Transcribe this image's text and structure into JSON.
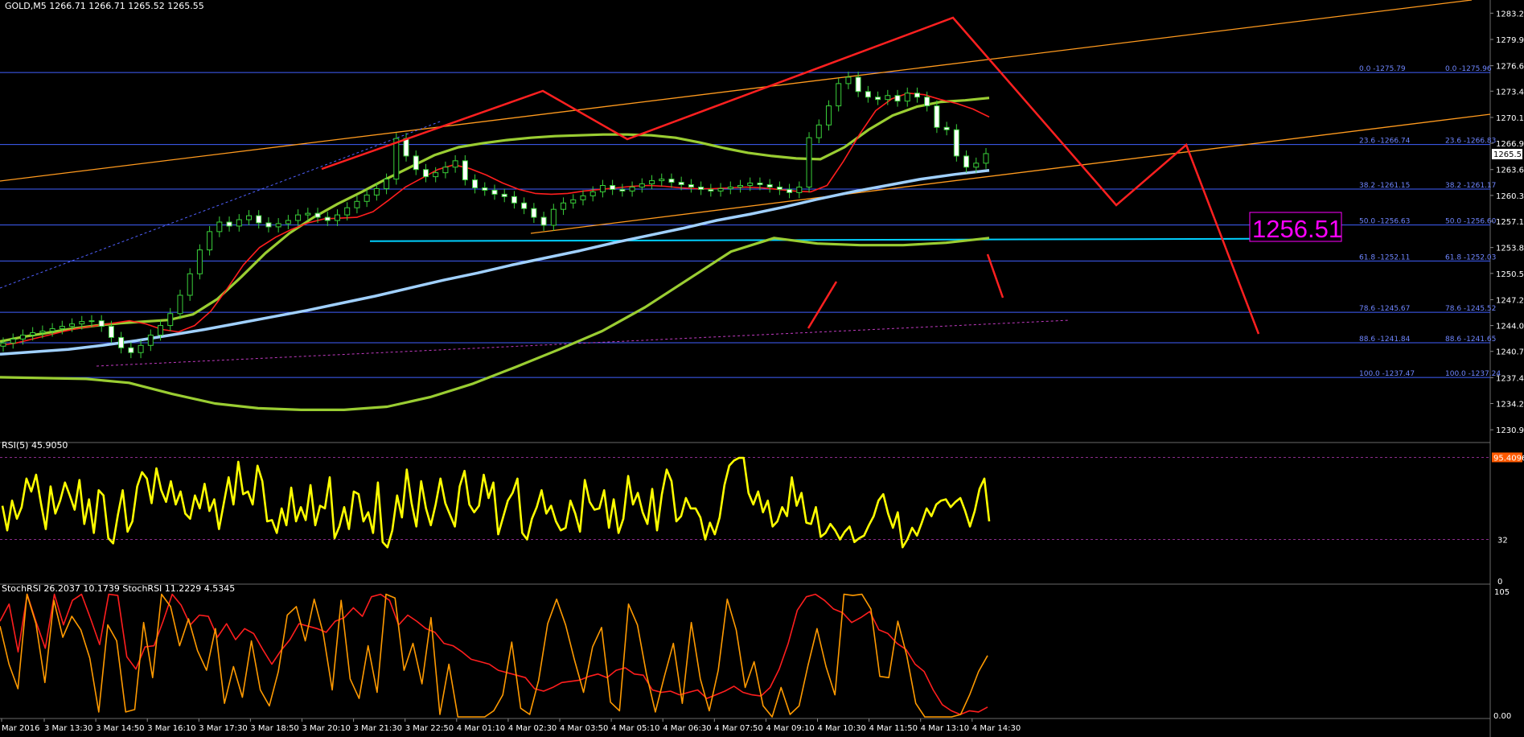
{
  "window": {
    "title": "GOLD,M5",
    "ohlc": "1266.71 1266.71 1265.52 1265.55",
    "current_price": "1265.55"
  },
  "colors": {
    "background": "#000000",
    "grid_fib": "#4060ff",
    "candle_up": "#3ad03a",
    "ma_red": "#ff1e1e",
    "ma_lime": "#9acd32",
    "ma_cyan": "#a0d0ff",
    "trend_orange": "#ff9a1e",
    "support_cyan": "#00d0ff",
    "arrow_red": "#ff2020",
    "target_magenta": "#ff00ff",
    "rsi_yellow": "#ffff00",
    "stoch_orange": "#ff9a00"
  },
  "target_label": "1256.51",
  "chart_data": [
    {
      "type": "line",
      "title": "GOLD,M5",
      "x_ticks": [
        "Mar 2016",
        "3 Mar 13:30",
        "3 Mar 14:50",
        "3 Mar 16:10",
        "3 Mar 17:30",
        "3 Mar 18:50",
        "3 Mar 20:10",
        "3 Mar 21:30",
        "3 Mar 22:50",
        "4 Mar 01:10",
        "4 Mar 02:30",
        "4 Mar 03:50",
        "4 Mar 05:10",
        "4 Mar 06:30",
        "4 Mar 07:50",
        "4 Mar 09:10",
        "4 Mar 10:30",
        "4 Mar 11:50",
        "4 Mar 13:10",
        "4 Mar 14:30"
      ],
      "y_ticks": [
        "1283.25",
        "1279.95",
        "1276.65",
        "1273.45",
        "1270.15",
        "1266.90",
        "1263.60",
        "1260.35",
        "1257.10",
        "1253.80",
        "1250.55",
        "1247.25",
        "1244.00",
        "1240.75",
        "1237.45",
        "1234.20",
        "1230.90"
      ],
      "ylim": [
        1229.5,
        1284.5
      ],
      "series": [
        {
          "type": "candlestick",
          "close": [
            1241.8,
            1242.3,
            1242.8,
            1243.1,
            1243.3,
            1243.6,
            1243.9,
            1244.2,
            1244.5,
            1244.6,
            1243.9,
            1242.5,
            1241.2,
            1240.6,
            1241.5,
            1242.8,
            1244.0,
            1245.5,
            1247.8,
            1250.5,
            1253.5,
            1255.8,
            1257.0,
            1256.5,
            1257.3,
            1257.8,
            1256.9,
            1256.4,
            1256.8,
            1257.2,
            1257.9,
            1258.1,
            1257.6,
            1257.2,
            1257.9,
            1258.8,
            1259.6,
            1260.4,
            1261.2,
            1262.4,
            1267.5,
            1265.3,
            1263.6,
            1262.7,
            1263.2,
            1263.9,
            1264.7,
            1262.3,
            1261.3,
            1261.0,
            1260.5,
            1260.2,
            1259.4,
            1258.7,
            1257.6,
            1256.6,
            1258.6,
            1259.4,
            1259.8,
            1260.3,
            1260.8,
            1261.6,
            1261.1,
            1260.9,
            1261.4,
            1261.8,
            1262.2,
            1262.4,
            1262.0,
            1261.7,
            1261.4,
            1261.1,
            1260.9,
            1261.2,
            1261.4,
            1261.6,
            1261.9,
            1261.7,
            1261.4,
            1261.1,
            1260.7,
            1261.4,
            1267.6,
            1269.2,
            1271.6,
            1274.4,
            1275.2,
            1273.4,
            1272.7,
            1272.4,
            1272.9,
            1272.2,
            1273.2,
            1272.7,
            1271.6,
            1268.9,
            1268.6,
            1265.3,
            1263.9,
            1264.4,
            1265.6
          ]
        },
        {
          "name": "",
          "values": [
            1241.5,
            1241.8,
            1242.3,
            1242.8,
            1243.3,
            1243.7,
            1244.0,
            1244.3,
            1244.6,
            1244.2,
            1243.5,
            1243.2,
            1244.0,
            1245.8,
            1248.6,
            1251.6,
            1253.8,
            1255.1,
            1256.1,
            1256.9,
            1257.4,
            1257.5,
            1257.6,
            1258.3,
            1259.8,
            1261.4,
            1262.5,
            1263.6,
            1264.2,
            1263.7,
            1262.9,
            1261.9,
            1261.1,
            1260.6,
            1260.5,
            1260.6,
            1260.9,
            1261.1,
            1261.3,
            1261.5,
            1261.6,
            1261.5,
            1261.3,
            1261.2,
            1261.2,
            1261.3,
            1261.4,
            1261.3,
            1261.1,
            1260.9,
            1260.8,
            1261.6,
            1264.6,
            1268.0,
            1271.0,
            1272.5,
            1273.2,
            1273.0,
            1272.4,
            1271.9,
            1271.2,
            1270.2
          ]
        },
        {
          "name": "",
          "values": [
            1242.0,
            1242.6,
            1243.1,
            1243.6,
            1244.0,
            1244.3,
            1244.5,
            1244.7,
            1245.4,
            1247.3,
            1250.1,
            1253.1,
            1255.6,
            1257.6,
            1259.3,
            1260.8,
            1262.4,
            1263.9,
            1265.4,
            1266.4,
            1266.9,
            1267.3,
            1267.6,
            1267.8,
            1267.9,
            1268.0,
            1268.0,
            1267.9,
            1267.6,
            1267.0,
            1266.3,
            1265.7,
            1265.3,
            1265.0,
            1264.9,
            1266.4,
            1268.6,
            1270.4,
            1271.5,
            1272.1,
            1272.3,
            1272.6
          ]
        },
        {
          "name": "",
          "values": [
            1240.4,
            1240.7,
            1241.0,
            1241.5,
            1242.1,
            1242.8,
            1243.5,
            1244.3,
            1245.1,
            1245.9,
            1246.8,
            1247.7,
            1248.7,
            1249.7,
            1250.6,
            1251.6,
            1252.5,
            1253.4,
            1254.4,
            1255.3,
            1256.2,
            1257.2,
            1258.0,
            1258.9,
            1259.9,
            1260.8,
            1261.6,
            1262.4,
            1263.0,
            1263.5
          ]
        },
        {
          "name": "",
          "values": [
            1237.5,
            1237.4,
            1237.3,
            1236.8,
            1235.4,
            1234.2,
            1233.6,
            1233.4,
            1233.4,
            1233.8,
            1235.0,
            1236.7,
            1238.8,
            1241.0,
            1243.3,
            1246.3,
            1249.8,
            1253.3,
            1255.0,
            1254.3,
            1254.1,
            1254.1,
            1254.4,
            1255.0
          ]
        }
      ],
      "fibonacci": [
        {
          "level": "0.0",
          "value": "1275.79",
          "value_right": "1275.96"
        },
        {
          "level": "23.6",
          "value": "1266.74",
          "value_right": "1266.83"
        },
        {
          "level": "38.2",
          "value": "1261.15",
          "value_right": "1261.17"
        },
        {
          "level": "50.0",
          "value": "1256.63",
          "value_right": "1256.60"
        },
        {
          "level": "61.8",
          "value": "1252.11",
          "value_right": "1252.03"
        },
        {
          "level": "78.6",
          "value": "1245.67",
          "value_right": "1245.52"
        },
        {
          "level": "88.6",
          "value": "1241.84",
          "value_right": "1241.65"
        },
        {
          "level": "100.0",
          "value": "1237.47",
          "value_right": "1237.24"
        }
      ],
      "support_level": 1254.9
    },
    {
      "type": "line",
      "title": "RSI(5) 45.9050",
      "y_ticks": [
        "95.4096",
        "32",
        "0"
      ],
      "ylim": [
        0,
        105
      ],
      "levels": [
        95.4,
        32
      ],
      "series": [
        {
          "name": "RSI(5)",
          "values": [
            58,
            39,
            62,
            48,
            57,
            79,
            69,
            82,
            60,
            40,
            73,
            52,
            62,
            76,
            66,
            55,
            78,
            44,
            63,
            37,
            70,
            66,
            33,
            29,
            51,
            70,
            38,
            46,
            73,
            84,
            79,
            60,
            87,
            70,
            61,
            77,
            59,
            69,
            52,
            48,
            66,
            56,
            75,
            54,
            63,
            40,
            60,
            80,
            59,
            92,
            67,
            69,
            59,
            89,
            77,
            46,
            47,
            37,
            56,
            43,
            72,
            46,
            57,
            47,
            74,
            43,
            58,
            56,
            80,
            33,
            42,
            57,
            40,
            69,
            67,
            46,
            53,
            37,
            76,
            30,
            26,
            39,
            66,
            49,
            86,
            60,
            42,
            77,
            56,
            43,
            59,
            79,
            60,
            51,
            42,
            73,
            85,
            59,
            53,
            58,
            82,
            64,
            76,
            36,
            49,
            62,
            68,
            79,
            37,
            32,
            48,
            57,
            70,
            52,
            58,
            46,
            39,
            41,
            62,
            52,
            38,
            78,
            61,
            55,
            56,
            70,
            41,
            63,
            37,
            48,
            81,
            59,
            68,
            53,
            44,
            71,
            39,
            67,
            86,
            77,
            46,
            50,
            64,
            56,
            56,
            49,
            32,
            45,
            36,
            49,
            74,
            89,
            93,
            95,
            95,
            68,
            59,
            69,
            53,
            62,
            42,
            46,
            57,
            50,
            80,
            58,
            68,
            45,
            44,
            57,
            34,
            37,
            44,
            39,
            32,
            38,
            42,
            30,
            33,
            35,
            43,
            50,
            62,
            67,
            52,
            41,
            53,
            26,
            32,
            41,
            35,
            45,
            56,
            50,
            59,
            62,
            63,
            57,
            61,
            64,
            54,
            42,
            54,
            71,
            79,
            46
          ]
        }
      ]
    },
    {
      "type": "line",
      "title": "StochRSI 26.2037 10.1739  StochRSI 11.2229 4.5345",
      "y_ticks": [
        "105",
        "0.00"
      ],
      "ylim": [
        0,
        105
      ],
      "series": [
        {
          "name": "StochRSI",
          "values": [
            78,
            92,
            53,
            100,
            77,
            56,
            100,
            75,
            95,
            100,
            80,
            59,
            100,
            99,
            49,
            39,
            57,
            58,
            78,
            100,
            91,
            75,
            83,
            82,
            65,
            76,
            63,
            72,
            68,
            55,
            43,
            54,
            63,
            76,
            74,
            72,
            69,
            78,
            81,
            89,
            82,
            98,
            100,
            95,
            75,
            83,
            78,
            72,
            69,
            60,
            58,
            53,
            47,
            45,
            43,
            38,
            36,
            34,
            32,
            23,
            21,
            24,
            28,
            29,
            30,
            33,
            35,
            32,
            38,
            40,
            35,
            34,
            22,
            20,
            21,
            18,
            20,
            22,
            15,
            18,
            21,
            25,
            20,
            18,
            17,
            24,
            39,
            60,
            87,
            98,
            100,
            95,
            88,
            85,
            77,
            81,
            86,
            71,
            68,
            60,
            55,
            43,
            37,
            22,
            10,
            5,
            2,
            5,
            4,
            8
          ]
        },
        {
          "name": "StochRSI",
          "values": [
            74,
            43,
            23,
            100,
            76,
            28,
            95,
            65,
            82,
            71,
            48,
            4,
            75,
            62,
            4,
            6,
            77,
            32,
            100,
            90,
            58,
            80,
            54,
            38,
            72,
            11,
            41,
            16,
            62,
            22,
            9,
            37,
            83,
            90,
            62,
            96,
            68,
            22,
            95,
            31,
            15,
            58,
            20,
            100,
            97,
            38,
            60,
            27,
            81,
            2,
            43,
            0,
            0,
            0,
            0,
            5,
            18,
            61,
            7,
            2,
            30,
            76,
            96,
            75,
            46,
            20,
            57,
            73,
            12,
            5,
            92,
            75,
            35,
            4,
            33,
            60,
            11,
            77,
            31,
            5,
            38,
            96,
            71,
            24,
            45,
            9,
            0,
            24,
            2,
            9,
            42,
            72,
            41,
            18,
            100,
            99,
            100,
            88,
            33,
            32,
            78,
            50,
            11,
            0,
            0,
            0,
            0,
            2,
            18,
            37,
            50
          ]
        }
      ]
    }
  ]
}
